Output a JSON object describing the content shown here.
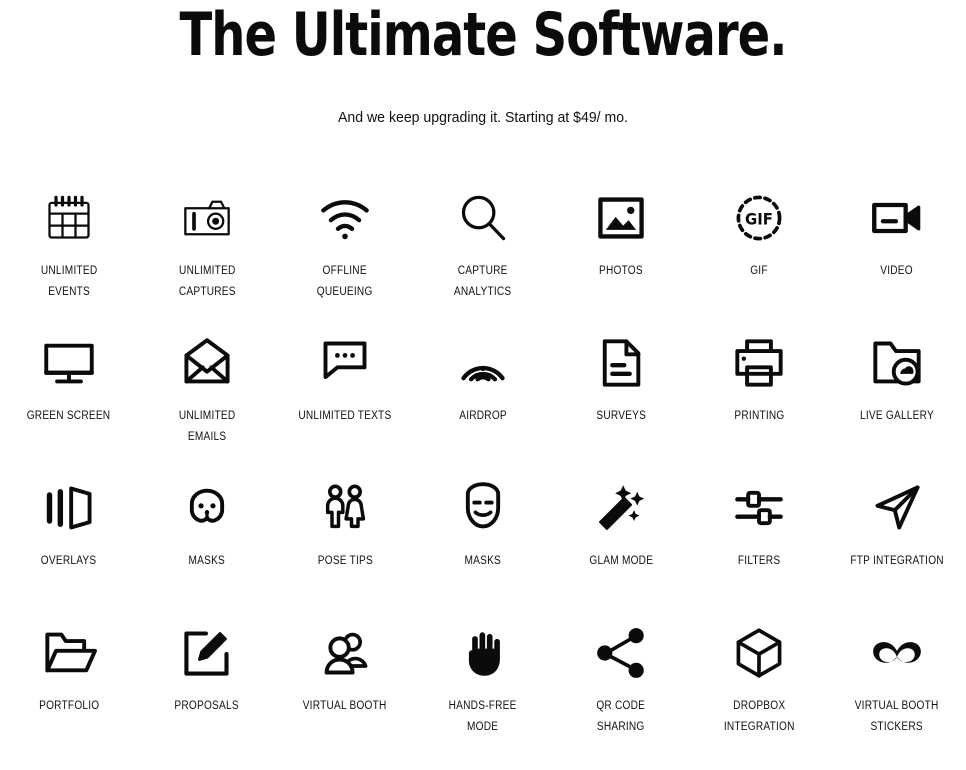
{
  "hero": {
    "title": "The Ultimate Software.",
    "subtitle": "And we keep upgrading it. Starting at $49/ mo."
  },
  "theme": {
    "background": "#ffffff",
    "ink": "#0b0b0b",
    "label_color": "#111111"
  },
  "features": [
    {
      "label": "UNLIMITED\nEVENTS",
      "icon": "calendar-icon"
    },
    {
      "label": "UNLIMITED\nCAPTURES",
      "icon": "camera-icon"
    },
    {
      "label": "OFFLINE\nQUEUEING",
      "icon": "wifi-icon"
    },
    {
      "label": "CAPTURE\nANALYTICS",
      "icon": "magnifier-icon"
    },
    {
      "label": "PHOTOS",
      "icon": "image-icon"
    },
    {
      "label": "GIF",
      "icon": "gif-icon"
    },
    {
      "label": "VIDEO",
      "icon": "video-camera-icon"
    },
    {
      "label": "GREEN SCREEN",
      "icon": "monitor-icon"
    },
    {
      "label": "UNLIMITED\nEMAILS",
      "icon": "envelope-icon"
    },
    {
      "label": "UNLIMITED TEXTS",
      "icon": "chat-bubble-icon"
    },
    {
      "label": "AIRDROP",
      "icon": "airdrop-icon"
    },
    {
      "label": "SURVEYS",
      "icon": "document-icon"
    },
    {
      "label": "PRINTING",
      "icon": "printer-icon"
    },
    {
      "label": "LIVE GALLERY",
      "icon": "folder-camera-icon"
    },
    {
      "label": "OVERLAYS",
      "icon": "layers-icon"
    },
    {
      "label": "MASKS",
      "icon": "dog-face-icon"
    },
    {
      "label": "POSE TIPS",
      "icon": "two-people-icon"
    },
    {
      "label": "MASKS",
      "icon": "theater-mask-icon"
    },
    {
      "label": "GLAM MODE",
      "icon": "magic-wand-icon"
    },
    {
      "label": "FILTERS",
      "icon": "sliders-icon"
    },
    {
      "label": "FTP INTEGRATION",
      "icon": "paper-plane-icon"
    },
    {
      "label": "PORTFOLIO",
      "icon": "open-folder-icon"
    },
    {
      "label": "PROPOSALS",
      "icon": "edit-square-icon"
    },
    {
      "label": "VIRTUAL BOOTH",
      "icon": "people-group-icon"
    },
    {
      "label": "HANDS-FREE\nMODE",
      "icon": "hand-icon"
    },
    {
      "label": "QR CODE\nSHARING",
      "icon": "share-nodes-icon"
    },
    {
      "label": "DROPBOX\nINTEGRATION",
      "icon": "cube-icon"
    },
    {
      "label": "VIRTUAL BOOTH\nSTICKERS",
      "icon": "mustache-icon"
    }
  ]
}
